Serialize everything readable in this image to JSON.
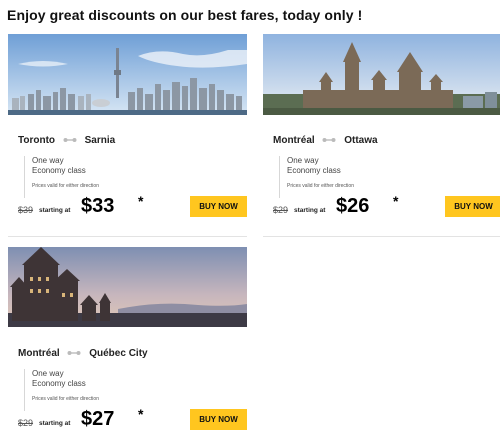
{
  "headline": "Enjoy great discounts on our best fares, today only !",
  "common": {
    "starting_label": "starting at",
    "buy_label": "BUY NOW",
    "asterisk": "*",
    "trip_type": "One way",
    "class": "Economy class",
    "note": "Prices valid for either direction"
  },
  "deals": [
    {
      "from": "Toronto",
      "to": "Sarnia",
      "old_price": "$39",
      "price": "$33",
      "image": "toronto-skyline-photo"
    },
    {
      "from": "Montréal",
      "to": "Ottawa",
      "old_price": "$29",
      "price": "$26",
      "image": "parliament-photo"
    },
    {
      "from": "Montréal",
      "to": "Québec City",
      "old_price": "$29",
      "price": "$27",
      "image": "chateau-photo"
    }
  ],
  "colors": {
    "buy_button": "#ffc61f",
    "separator": "#e3e3e3"
  }
}
